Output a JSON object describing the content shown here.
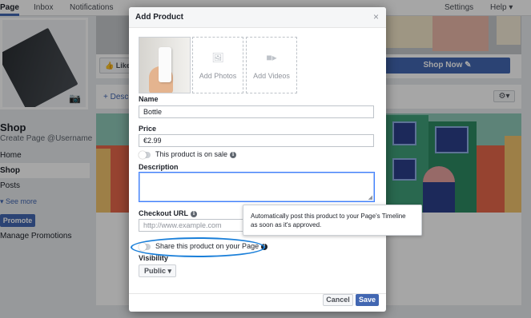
{
  "topnav": {
    "items": [
      "Page",
      "Inbox",
      "Notifications",
      "Settings",
      "Help ▾"
    ]
  },
  "left": {
    "title": "Shop",
    "username": "Create Page @Username",
    "nav": [
      "Home",
      "Shop",
      "Posts"
    ],
    "see_more": "▾ See more",
    "promote": "Promote",
    "manage": "Manage Promotions"
  },
  "page": {
    "like_label": "👍 Like",
    "shop_now": "Shop Now ✎",
    "add_description": "+ Desc",
    "gear": "⚙▾"
  },
  "modal": {
    "title": "Add Product",
    "close": "×",
    "add_photos": "Add Photos",
    "add_videos": "Add Videos",
    "name_label": "Name",
    "name_value": "Bottle",
    "price_label": "Price",
    "price_value": "€2.99",
    "sale_label": "This product is on sale",
    "description_label": "Description",
    "checkout_label": "Checkout URL",
    "checkout_placeholder": "http://www.example.com",
    "share_label": "Share this product on your Page",
    "visibility_label": "Visibility",
    "visibility_value": "Public ▾",
    "cancel": "Cancel",
    "save": "Save"
  },
  "tooltip": {
    "text": "Automatically post this product to your Page's Timeline as soon as it's approved."
  },
  "colors": {
    "accent": "#4267b2",
    "highlight": "#1a7fd9"
  }
}
